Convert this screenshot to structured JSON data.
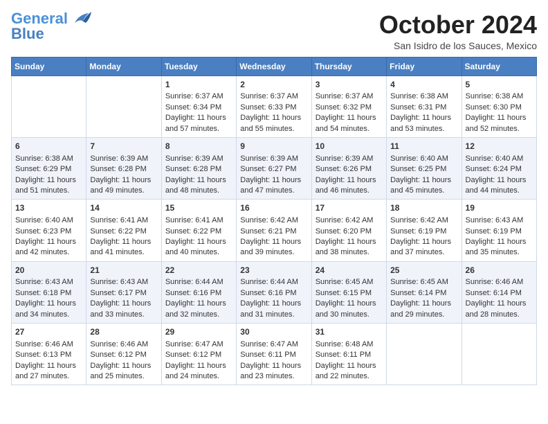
{
  "header": {
    "logo_line1": "General",
    "logo_line2": "Blue",
    "month_title": "October 2024",
    "subtitle": "San Isidro de los Sauces, Mexico"
  },
  "days_of_week": [
    "Sunday",
    "Monday",
    "Tuesday",
    "Wednesday",
    "Thursday",
    "Friday",
    "Saturday"
  ],
  "weeks": [
    [
      {
        "day": "",
        "content": ""
      },
      {
        "day": "",
        "content": ""
      },
      {
        "day": "1",
        "content": "Sunrise: 6:37 AM\nSunset: 6:34 PM\nDaylight: 11 hours and 57 minutes."
      },
      {
        "day": "2",
        "content": "Sunrise: 6:37 AM\nSunset: 6:33 PM\nDaylight: 11 hours and 55 minutes."
      },
      {
        "day": "3",
        "content": "Sunrise: 6:37 AM\nSunset: 6:32 PM\nDaylight: 11 hours and 54 minutes."
      },
      {
        "day": "4",
        "content": "Sunrise: 6:38 AM\nSunset: 6:31 PM\nDaylight: 11 hours and 53 minutes."
      },
      {
        "day": "5",
        "content": "Sunrise: 6:38 AM\nSunset: 6:30 PM\nDaylight: 11 hours and 52 minutes."
      }
    ],
    [
      {
        "day": "6",
        "content": "Sunrise: 6:38 AM\nSunset: 6:29 PM\nDaylight: 11 hours and 51 minutes."
      },
      {
        "day": "7",
        "content": "Sunrise: 6:39 AM\nSunset: 6:28 PM\nDaylight: 11 hours and 49 minutes."
      },
      {
        "day": "8",
        "content": "Sunrise: 6:39 AM\nSunset: 6:28 PM\nDaylight: 11 hours and 48 minutes."
      },
      {
        "day": "9",
        "content": "Sunrise: 6:39 AM\nSunset: 6:27 PM\nDaylight: 11 hours and 47 minutes."
      },
      {
        "day": "10",
        "content": "Sunrise: 6:39 AM\nSunset: 6:26 PM\nDaylight: 11 hours and 46 minutes."
      },
      {
        "day": "11",
        "content": "Sunrise: 6:40 AM\nSunset: 6:25 PM\nDaylight: 11 hours and 45 minutes."
      },
      {
        "day": "12",
        "content": "Sunrise: 6:40 AM\nSunset: 6:24 PM\nDaylight: 11 hours and 44 minutes."
      }
    ],
    [
      {
        "day": "13",
        "content": "Sunrise: 6:40 AM\nSunset: 6:23 PM\nDaylight: 11 hours and 42 minutes."
      },
      {
        "day": "14",
        "content": "Sunrise: 6:41 AM\nSunset: 6:22 PM\nDaylight: 11 hours and 41 minutes."
      },
      {
        "day": "15",
        "content": "Sunrise: 6:41 AM\nSunset: 6:22 PM\nDaylight: 11 hours and 40 minutes."
      },
      {
        "day": "16",
        "content": "Sunrise: 6:42 AM\nSunset: 6:21 PM\nDaylight: 11 hours and 39 minutes."
      },
      {
        "day": "17",
        "content": "Sunrise: 6:42 AM\nSunset: 6:20 PM\nDaylight: 11 hours and 38 minutes."
      },
      {
        "day": "18",
        "content": "Sunrise: 6:42 AM\nSunset: 6:19 PM\nDaylight: 11 hours and 37 minutes."
      },
      {
        "day": "19",
        "content": "Sunrise: 6:43 AM\nSunset: 6:19 PM\nDaylight: 11 hours and 35 minutes."
      }
    ],
    [
      {
        "day": "20",
        "content": "Sunrise: 6:43 AM\nSunset: 6:18 PM\nDaylight: 11 hours and 34 minutes."
      },
      {
        "day": "21",
        "content": "Sunrise: 6:43 AM\nSunset: 6:17 PM\nDaylight: 11 hours and 33 minutes."
      },
      {
        "day": "22",
        "content": "Sunrise: 6:44 AM\nSunset: 6:16 PM\nDaylight: 11 hours and 32 minutes."
      },
      {
        "day": "23",
        "content": "Sunrise: 6:44 AM\nSunset: 6:16 PM\nDaylight: 11 hours and 31 minutes."
      },
      {
        "day": "24",
        "content": "Sunrise: 6:45 AM\nSunset: 6:15 PM\nDaylight: 11 hours and 30 minutes."
      },
      {
        "day": "25",
        "content": "Sunrise: 6:45 AM\nSunset: 6:14 PM\nDaylight: 11 hours and 29 minutes."
      },
      {
        "day": "26",
        "content": "Sunrise: 6:46 AM\nSunset: 6:14 PM\nDaylight: 11 hours and 28 minutes."
      }
    ],
    [
      {
        "day": "27",
        "content": "Sunrise: 6:46 AM\nSunset: 6:13 PM\nDaylight: 11 hours and 27 minutes."
      },
      {
        "day": "28",
        "content": "Sunrise: 6:46 AM\nSunset: 6:12 PM\nDaylight: 11 hours and 25 minutes."
      },
      {
        "day": "29",
        "content": "Sunrise: 6:47 AM\nSunset: 6:12 PM\nDaylight: 11 hours and 24 minutes."
      },
      {
        "day": "30",
        "content": "Sunrise: 6:47 AM\nSunset: 6:11 PM\nDaylight: 11 hours and 23 minutes."
      },
      {
        "day": "31",
        "content": "Sunrise: 6:48 AM\nSunset: 6:11 PM\nDaylight: 11 hours and 22 minutes."
      },
      {
        "day": "",
        "content": ""
      },
      {
        "day": "",
        "content": ""
      }
    ]
  ]
}
